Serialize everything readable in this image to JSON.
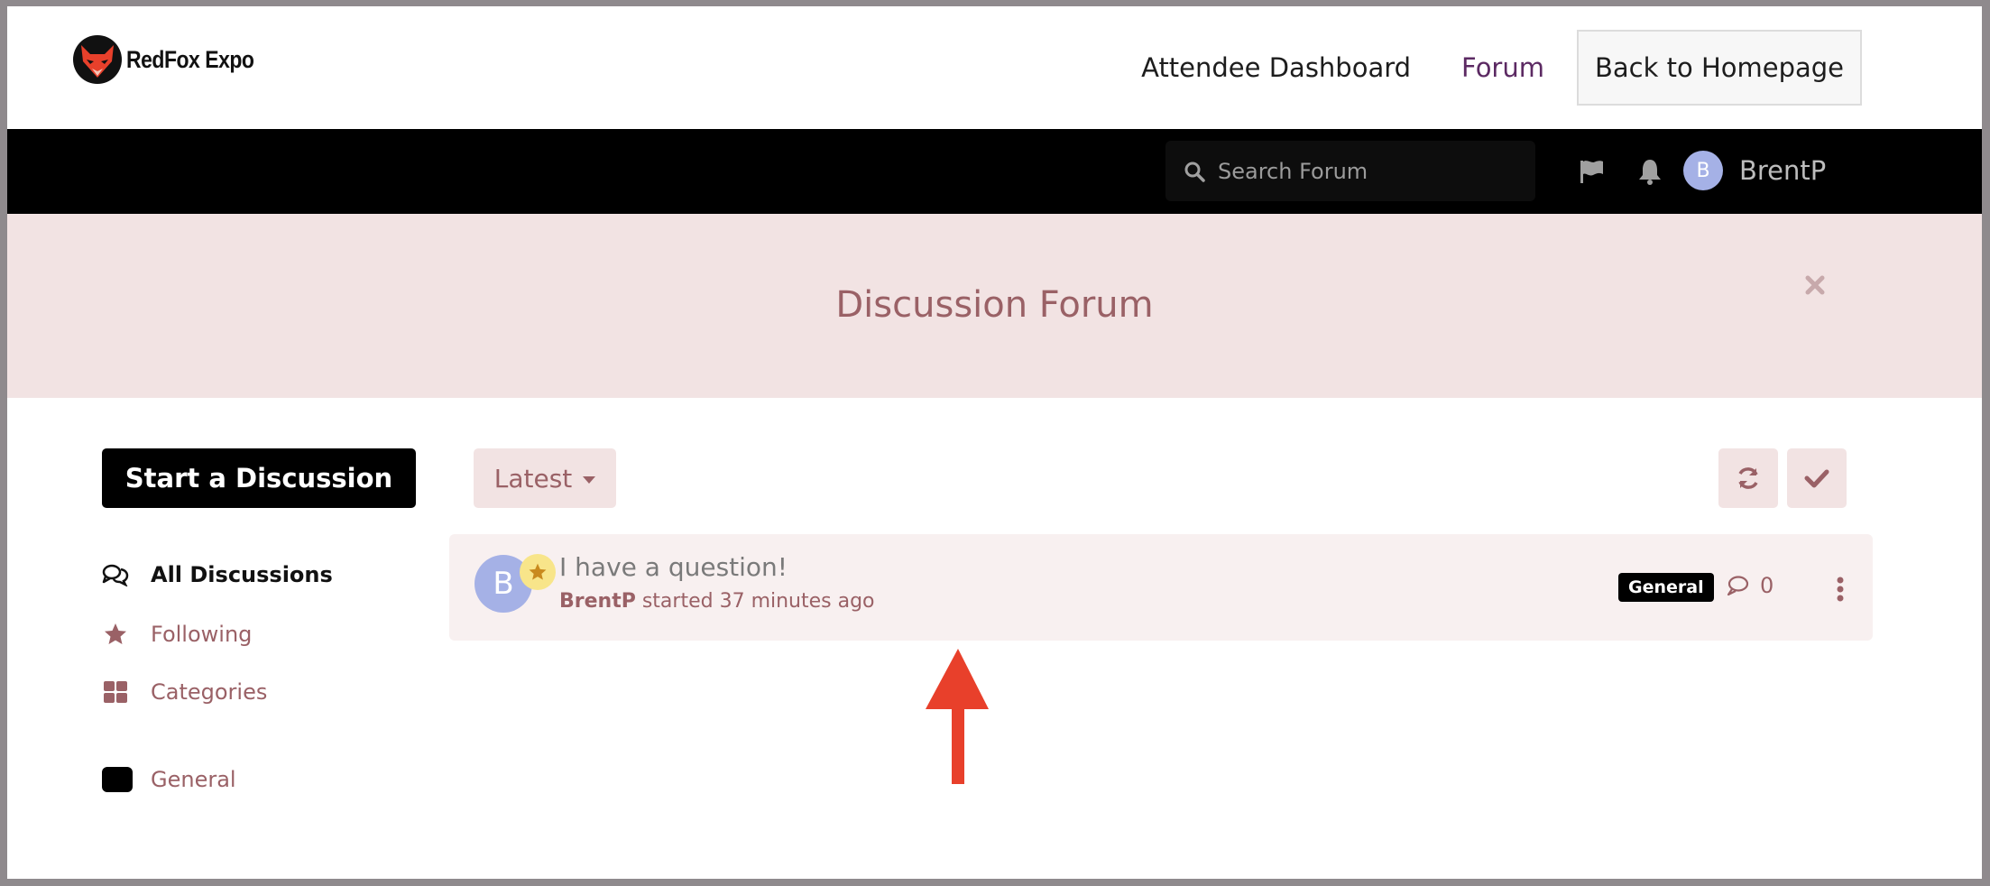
{
  "site": {
    "logo_text": "RedFox Expo",
    "nav": {
      "dashboard": "Attendee Dashboard",
      "forum": "Forum",
      "back": "Back to Homepage"
    }
  },
  "forum_bar": {
    "search_placeholder": "Search Forum",
    "icons": [
      "flag-icon",
      "bell-icon"
    ],
    "user": {
      "initial": "B",
      "name": "BrentP"
    }
  },
  "hero": {
    "title": "Discussion Forum"
  },
  "sidebar": {
    "start_label": "Start a Discussion",
    "items": [
      {
        "label": "All Discussions",
        "icon": "comments-icon",
        "active": true
      },
      {
        "label": "Following",
        "icon": "star-icon"
      },
      {
        "label": "Categories",
        "icon": "grid-icon"
      }
    ],
    "tags": [
      {
        "label": "General",
        "color": "#000000"
      }
    ]
  },
  "toolbar": {
    "sort_label": "Latest",
    "refresh_icon": "refresh-icon",
    "mark_read_icon": "check-icon"
  },
  "discussions": [
    {
      "initial": "B",
      "title": "I have a question!",
      "author": "BrentP",
      "time": "started 37 minutes ago",
      "tag": "General",
      "replies": "0"
    }
  ],
  "colors": {
    "accent": "#9a6166",
    "hero_bg": "#f2e3e3",
    "avatar": "#a5b1e6",
    "annotation_arrow": "#e8402b"
  }
}
